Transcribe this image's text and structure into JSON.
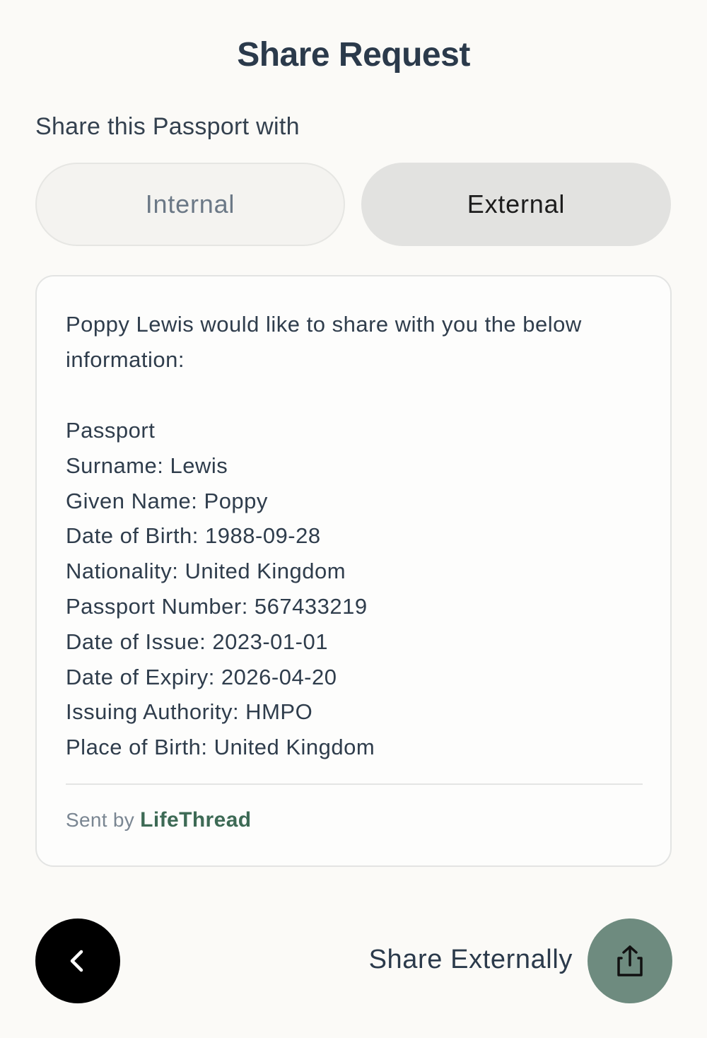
{
  "header": {
    "title": "Share Request"
  },
  "share_target": {
    "prompt": "Share this Passport with",
    "options": [
      {
        "label": "Internal",
        "selected": false
      },
      {
        "label": "External",
        "selected": true
      }
    ]
  },
  "card": {
    "message": "Poppy Lewis would like to share with you the below information:",
    "document_type": "Passport",
    "fields": [
      "Surname: Lewis",
      "Given Name: Poppy",
      "Date of Birth: 1988-09-28",
      "Nationality: United Kingdom",
      "Passport Number: 567433219",
      "Date of Issue: 2023-01-01",
      "Date of Expiry: 2026-04-20",
      "Issuing Authority: HMPO",
      "Place of Birth: United Kingdom"
    ],
    "sent_by_prefix": "Sent by",
    "brand": "LifeThread"
  },
  "footer": {
    "back_icon": "chevron-left-icon",
    "share_label": "Share Externally",
    "share_icon": "share-upload-icon"
  },
  "colors": {
    "background": "#fbfaf7",
    "text_dark": "#2b3a4b",
    "brand_green": "#3d6a55",
    "share_button": "#6e8b7f",
    "back_button": "#000000",
    "selected_toggle": "#e2e2e0"
  }
}
